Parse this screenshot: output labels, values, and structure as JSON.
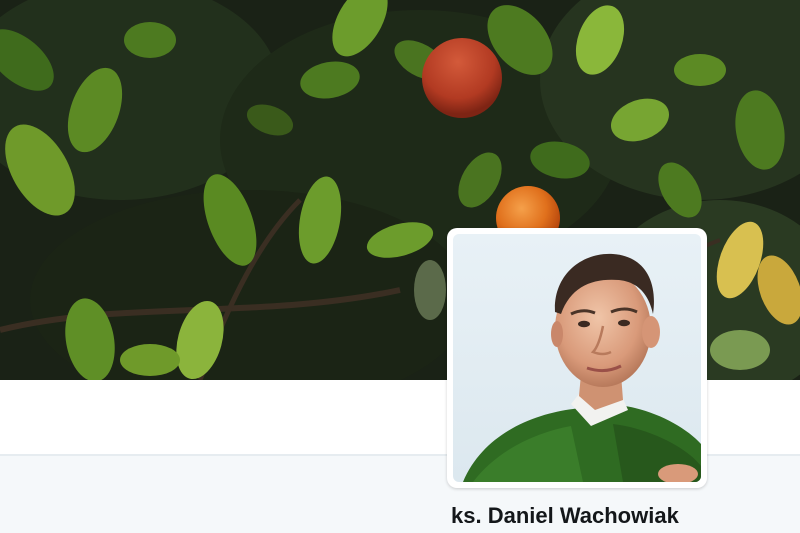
{
  "profile": {
    "display_name": "ks. Daniel Wachowiak"
  },
  "images": {
    "header": "orange-tree-foliage-photo",
    "avatar": "portrait-photo-man-green-vestment"
  },
  "colors": {
    "content_background": "#f5f8fa",
    "divider": "#e6ecf0",
    "name_text": "#14171a",
    "leaf_green": "#4e7a1e",
    "orange_fruit": "#e0701c",
    "vestment_green": "#2f6b22"
  }
}
